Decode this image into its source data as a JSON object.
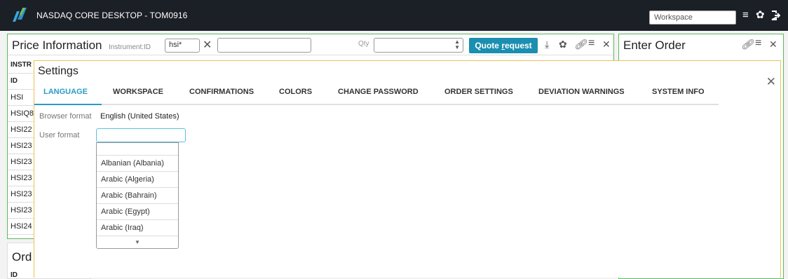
{
  "app": {
    "title": "NASDAQ CORE DESKTOP - TOM0916",
    "workspace_value": "Workspace"
  },
  "price_panel": {
    "title": "Price Information",
    "instrument_label": "Instrument:ID",
    "instrument_value": "hsi*",
    "qty_label": "Qty",
    "quote_prefix": "Quote ",
    "quote_underlined": "r",
    "quote_suffix": "equest",
    "col_header": "INSTR",
    "id_header": "ID",
    "rows": [
      "HSI",
      "HSIQ8",
      "HSI22",
      "HSI23",
      "HSI23",
      "HSI23",
      "HSI23",
      "HSI23",
      "HSI24"
    ]
  },
  "order_panel": {
    "title": "Ord",
    "id_header": "ID"
  },
  "enter_order": {
    "title": "Enter Order"
  },
  "settings": {
    "title": "Settings",
    "tabs": [
      "LANGUAGE",
      "WORKSPACE",
      "CONFIRMATIONS",
      "COLORS",
      "CHANGE PASSWORD",
      "ORDER SETTINGS",
      "DEVIATION WARNINGS",
      "SYSTEM INFO"
    ],
    "browser_format_label": "Browser format",
    "browser_format_value": "English (United States)",
    "user_format_label": "User format",
    "user_format_value": "",
    "options": [
      "",
      "Albanian (Albania)",
      "Arabic (Algeria)",
      "Arabic (Bahrain)",
      "Arabic (Egypt)",
      "Arabic (Iraq)"
    ]
  },
  "colors": {
    "accent": "#2a9bc7",
    "button": "#1a8fb0",
    "panel_border": "#5cb85c",
    "dialog_border": "#e8c15a",
    "topbar": "#1b1f26"
  },
  "icons": [
    "nasdaq-logo",
    "menu-icon",
    "gear-icon",
    "logout-icon",
    "close-icon",
    "download-icon",
    "link-icon",
    "chevron-down-icon"
  ]
}
